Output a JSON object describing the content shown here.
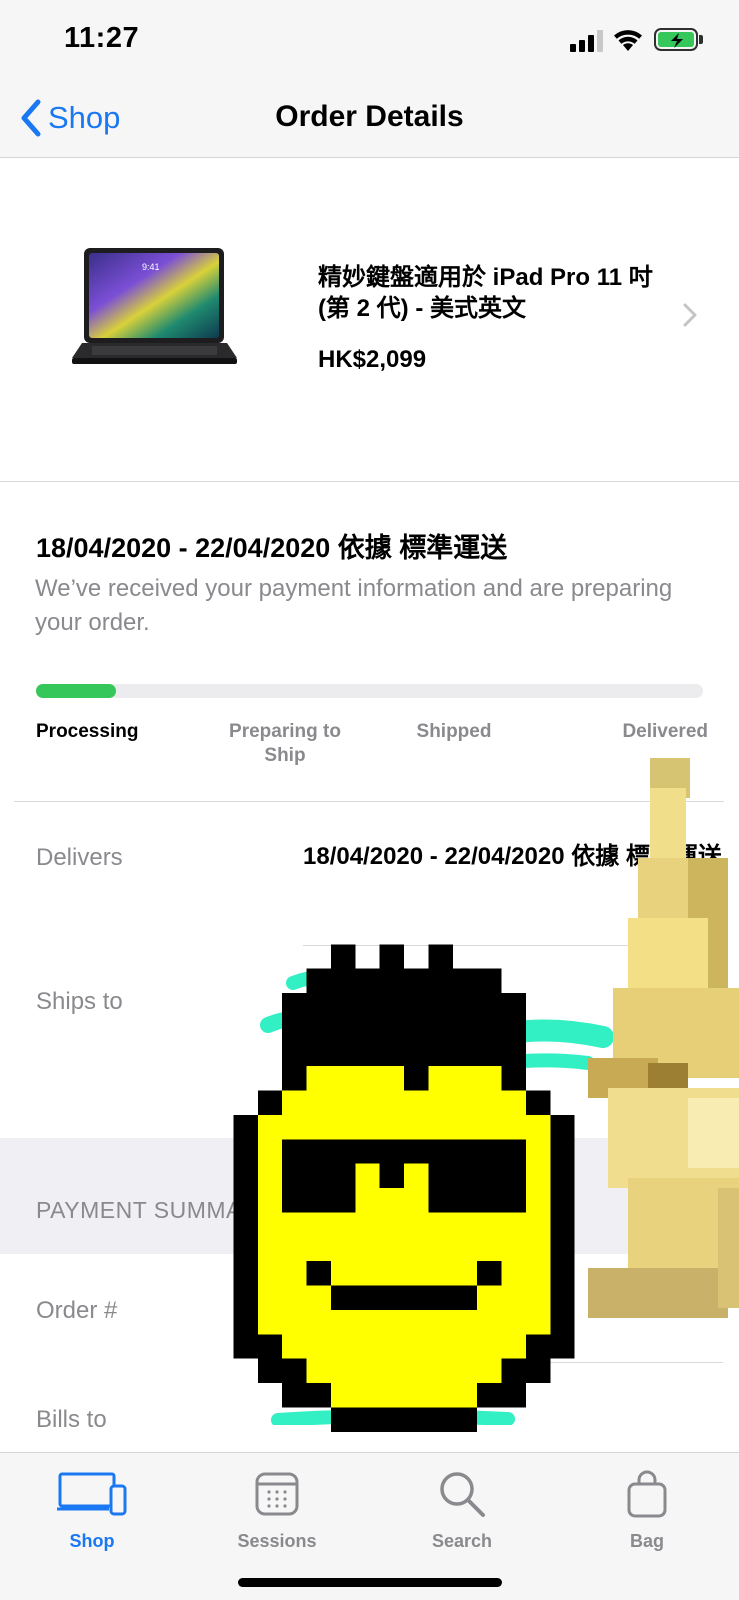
{
  "status_bar": {
    "time": "11:27"
  },
  "nav": {
    "back_label": "Shop",
    "title": "Order Details"
  },
  "product": {
    "name": "精妙鍵盤適用於 iPad Pro 11 吋 (第 2 代) - 美式英文",
    "price": "HK$2,099",
    "image_icon": "ipad-keyboard-image"
  },
  "shipping": {
    "date_line": "18/04/2020 - 22/04/2020 依據 標準運送",
    "message": "We’ve received your payment information and are preparing your order.",
    "progress": 0.12,
    "steps": [
      "Processing",
      "Preparing to Ship",
      "Shipped",
      "Delivered"
    ],
    "active_step": 0
  },
  "details": {
    "delivers_label": "Delivers",
    "delivers_value": "18/04/2020 - 22/04/2020 依據 標準運送",
    "ships_to_label": "Ships to",
    "payment_summary_header": "PAYMENT SUMMARY",
    "order_label": "Order #",
    "bills_to_label": "Bills to"
  },
  "tabs": [
    {
      "label": "Shop",
      "icon": "devices-icon",
      "active": true
    },
    {
      "label": "Sessions",
      "icon": "calendar-icon",
      "active": false
    },
    {
      "label": "Search",
      "icon": "search-icon",
      "active": false
    },
    {
      "label": "Bag",
      "icon": "bag-icon",
      "active": false
    }
  ],
  "colors": {
    "accent": "#1a78f2",
    "progress": "#35c759",
    "secondary_text": "#8a8a8e"
  }
}
